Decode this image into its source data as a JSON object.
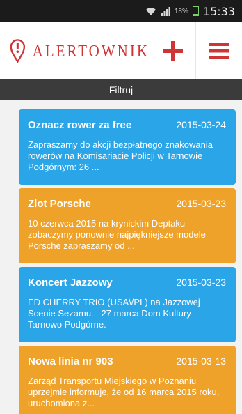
{
  "statusbar": {
    "battery_percent": "18%",
    "time": "15:33",
    "icons": [
      "wifi-icon",
      "signal-icon",
      "battery-icon"
    ]
  },
  "header": {
    "app_name": "ALERTOWNIK",
    "add_icon": "plus-icon",
    "menu_icon": "hamburger-menu-icon",
    "logo_icon": "alert-pin-icon"
  },
  "filter": {
    "label": "Filtruj"
  },
  "colors": {
    "brand_red": "#d03535",
    "card_blue": "#2aa5e8",
    "card_orange": "#efa22a",
    "filter_bar": "#3b3b3b"
  },
  "alerts": [
    {
      "title": "Oznacz rower za free",
      "date": "2015-03-24",
      "text": "Zapraszamy do akcji bezpłatnego znakowania rowerów na Komisariacie Policji w Tarnowie Podgórnym: 26 ...",
      "color": "blue"
    },
    {
      "title": "Zlot Porsche",
      "date": "2015-03-23",
      "text": "10 czerwca 2015 na krynickim Deptaku zobaczymy ponownie najpiękniejsze modele Porsche zapraszamy od ...",
      "color": "orange"
    },
    {
      "title": "Koncert Jazzowy",
      "date": "2015-03-23",
      "text": "ED CHERRY TRIO (USA\\/PL) na Jazzowej Scenie Sezamu – 27 marca Dom Kultury Tarnowo Podgórne.",
      "color": "blue"
    },
    {
      "title": "Nowa linia nr 903",
      "date": "2015-03-13",
      "text": "Zarząd Transportu Miejskiego w Poznaniu uprzejmie informuje, że od 16 marca 2015 roku, uruchomiona z...",
      "color": "orange"
    }
  ]
}
